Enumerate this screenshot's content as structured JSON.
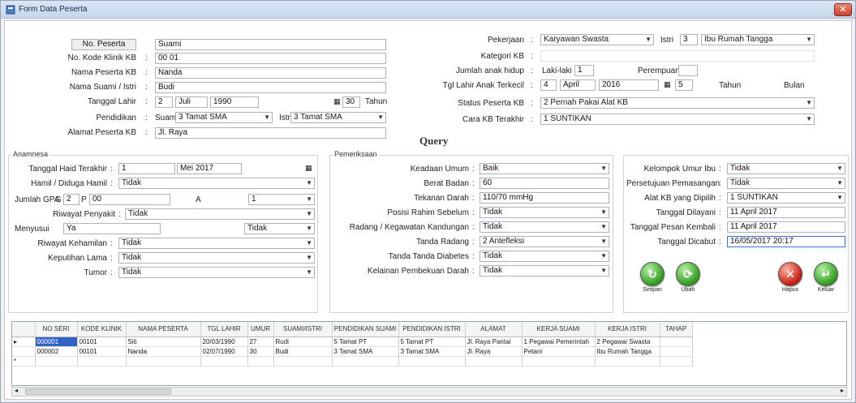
{
  "window": {
    "title": "Form Data Peserta"
  },
  "identity": {
    "no_peserta_label": "No. Peserta",
    "no_peserta_value": "Suami",
    "no_kode_label": "No. Kode Klinik KB",
    "no_kode_value": "00 01",
    "nama_peserta_label": "Nama Peserta KB",
    "nama_peserta_value": "Nanda",
    "nama_suami_label": "Nama Suami / Istri",
    "nama_suami_value": "Budi",
    "tgl_lahir_label": "Tanggal Lahir",
    "tgl_lahir_day": "2",
    "tgl_lahir_month": "Juli",
    "tgl_lahir_year": "1990",
    "umur_value": "30",
    "umur_unit": "Tahun",
    "pendidikan_label": "Pendidikan",
    "pendidikan_suami_label": "Suami",
    "pendidikan_suami_value": "3 Tamat SMA",
    "pendidikan_istri_label": "Istri",
    "pendidikan_istri_value": "3 Tamat SMA",
    "alamat_label": "Alamat Peserta KB",
    "alamat_value": "Jl. Raya",
    "pekerjaan_label": "Pekerjaan",
    "pekerjaan_suami": "Karyawan Swasta",
    "pekerjaan_istri": "Ibu Rumah Tangga",
    "istri_label": "Istri",
    "istri_no": "3",
    "kategori_label": "Kategori KB",
    "jumlah_anak_label": "Jumlah anak hidup",
    "jumlah_anak_laki_label": "Laki-laki",
    "jumlah_anak_laki_value": "1",
    "jumlah_anak_perempuan_label": "Perempuan",
    "tgl_anak_terkecil_label": "Tgl Lahir Anak Terkecil",
    "tgl_anak_day": "4",
    "tgl_anak_month": "April",
    "tgl_anak_year": "2016",
    "tgl_anak_umur": "5",
    "tgl_anak_tahun_label": "Tahun",
    "tgl_anak_bulan_label": "Bulan",
    "status_label": "Status Peserta KB",
    "status_value": "2 Pernah Pakai Alat KB",
    "cara_kb_label": "Cara KB Terakhir",
    "cara_kb_value": "1 SUNTIKAN"
  },
  "query_title": "Query",
  "anamnesa": {
    "group_label": "Anamnesa",
    "haid_label": "Tanggal Haid Terakhir",
    "haid_day": "1",
    "haid_month": "Mei",
    "haid_year": "2017",
    "hamil_label": "Hamil / Diduga Hamil",
    "hamil_value": "Tidak",
    "gpa_label": "Jumlah GPA",
    "g_label": "G",
    "p_label": "P",
    "a_label": "A",
    "g_value": "2",
    "p_value": "00",
    "a_value": "1",
    "menyusui_label": "Menyusui",
    "menyusui_value": "Ya",
    "riwayat_label": "Riwayat Penyakit",
    "riwayat_value": "Tidak",
    "riwayat_kehamilan_label": "Riwayat Kehamilan",
    "riwayat_kehamilan_value": "Tidak",
    "keputihan_label": "Keputihan Lama",
    "keputihan_value": "Tidak",
    "tumor_label": "Tumor",
    "tumor_value": "Tidak"
  },
  "pemeriksaan": {
    "group_label": "Pemeriksaan",
    "keadaan_label": "Keadaan Umum",
    "keadaan_value": "Baik",
    "berat_label": "Berat Badan",
    "berat_value": "60",
    "tekanan_label": "Tekanan Darah",
    "tekanan_value": "110/70 mmHg",
    "posisi_label": "Posisi Rahim Sebelum",
    "posisi_value": "Tidak",
    "radang_label": "Radang / Kegawatan Kandungan",
    "radang_value": "Tidak",
    "tanda_label": "Tanda Radang",
    "tanda_value": "2 Antefleksi",
    "tanda_diabetes_label": "Tanda Tanda Diabetes",
    "tanda_diabetes_value": "Tidak",
    "kelainan_label": "Kelainan Pembekuan Darah",
    "kelainan_value": "Tidak"
  },
  "right_panel": {
    "keluarga_label": "Kelompok Umur Ibu",
    "keluarga_value": "Tidak",
    "persetujuan_label": "Persetujuan Pemasangan",
    "persetujuan_value": "Tidak",
    "alat_label": "Alat KB yang Dipilih",
    "alat_value": "1 SUNTIKAN",
    "tgl_dilayani_label": "Tanggal Dilayani",
    "tgl_dilayani_value": "11 April 2017",
    "tgl_pesan_label": "Tanggal Pesan Kembali",
    "tgl_pesan_value": "11 April 2017",
    "tgl_lepas_label": "Tanggal Dicabut",
    "tgl_lepas_value": "16/05/2017 20:17"
  },
  "buttons": {
    "simpan": "Simpan",
    "ubah": "Ubah",
    "hapus": "Hapus",
    "keluar": "Keluar"
  },
  "grid": {
    "columns": [
      "NO SERI",
      "KODE KLINIK",
      "NAMA PESERTA",
      "TGL LAHIR",
      "UMUR",
      "SUAMI/ISTRI",
      "PENDIDIKAN SUAMI",
      "PENDIDIKAN ISTRI",
      "ALAMAT",
      "KERJA SUAMI",
      "KERJA ISTRI",
      "TAHAP"
    ],
    "rows": [
      [
        "000001",
        "00101",
        "Siti",
        "20/03/1990",
        "27",
        "Rudi",
        "5 Tamat PT",
        "5 Tamat PT",
        "Jl. Raya Pantai",
        "1 Pegawai Pemerintah",
        "2 Pegawai Swasta",
        ""
      ],
      [
        "000002",
        "00101",
        "Nanda",
        "02/07/1990",
        "30",
        "Budi",
        "3 Tamat SMA",
        "3 Tamat SMA",
        "Jl. Raya",
        "Petani",
        "Ibu Rumah Tangga",
        ""
      ]
    ]
  }
}
